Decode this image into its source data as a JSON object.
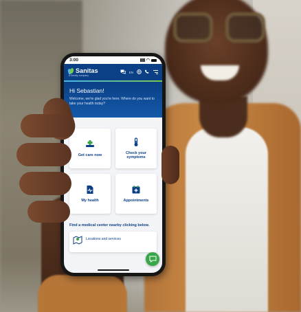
{
  "status_bar": {
    "time": "3:00"
  },
  "app": {
    "brand": "Sanitas",
    "brand_sub": "a Keralty company",
    "language": "EN"
  },
  "hero": {
    "greeting": "Hi Sebastian!",
    "welcome": "Welcome, we're glad you're here. Where do you want to take your health today?"
  },
  "cards": [
    {
      "label": "Get care now",
      "icon": "first-aid-icon"
    },
    {
      "label": "Check your symptoms",
      "icon": "thermometer-icon"
    },
    {
      "label": "My health",
      "icon": "health-chart-icon"
    },
    {
      "label": "Appointments",
      "icon": "calendar-plus-icon"
    }
  ],
  "nearby": {
    "text": "Find a medical center nearby clicking below.",
    "location_card_label": "Locations and services"
  },
  "colors": {
    "brand_blue": "#0b3f86",
    "accent_green": "#3aa64a",
    "accent_lightblue": "#4bb6e8"
  }
}
